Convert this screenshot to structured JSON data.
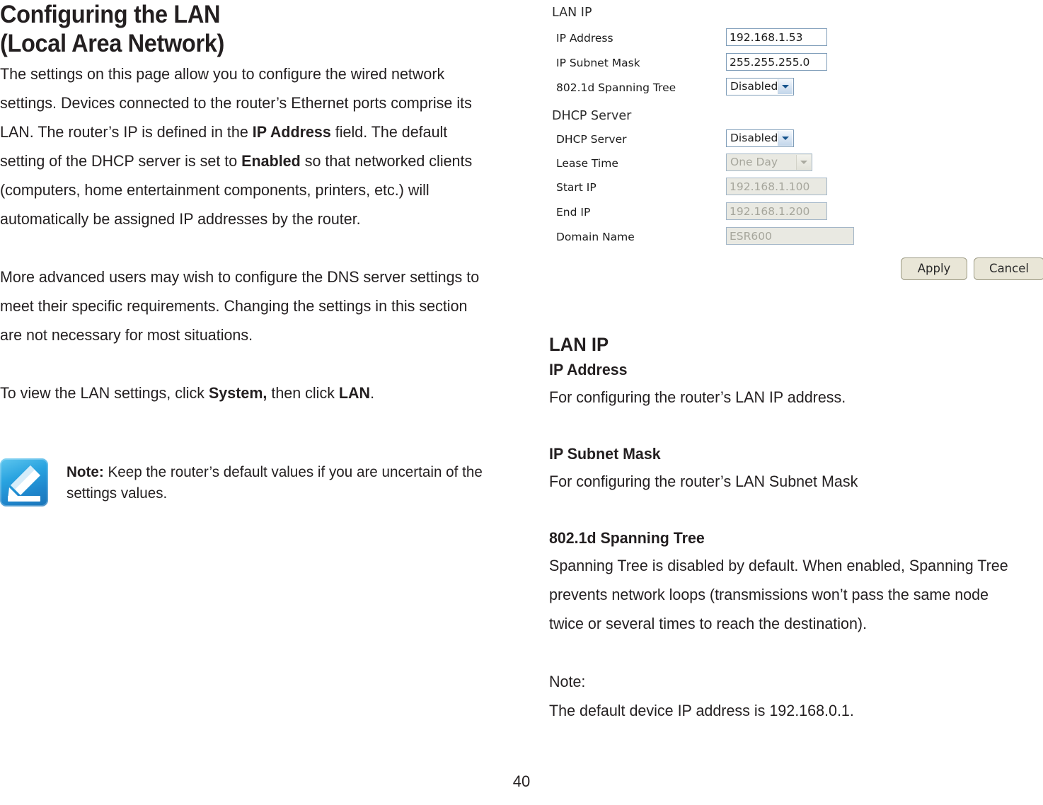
{
  "document": {
    "page_number": "40"
  },
  "left": {
    "heading_line1": "Configuring the LAN",
    "heading_line2": "(Local Area Network)",
    "para1_part1": "The settings on this page allow you to configure the wired network settings. Devices connected to the router’s Ethernet ports comprise its LAN. The router’s IP is defined in the ",
    "para1_bold1": "IP Address",
    "para1_part2": " field. The default setting of the DHCP server is set to ",
    "para1_bold2": "Enabled",
    "para1_part3": " so that networked clients (computers, home entertainment components, printers, etc.) will automatically be assigned IP addresses by the router.",
    "para2": "More advanced users may wish to configure the DNS server settings to meet their specific requirements. Changing the settings in this section are not necessary for most situations.",
    "para3_part1": "To view the LAN settings, click ",
    "para3_bold1": "System,",
    "para3_part2": " then click ",
    "para3_bold2": "LAN",
    "para3_part3": ".",
    "note_label": "Note:",
    "note_text": " Keep the router’s default values if you are uncertain of the settings values."
  },
  "right": {
    "section_heading": "LAN IP",
    "items": [
      {
        "heading": "IP Address",
        "body": "For configuring the router’s LAN IP address."
      },
      {
        "heading": "IP Subnet Mask",
        "body": "For configuring the router’s LAN Subnet Mask"
      },
      {
        "heading": "802.1d Spanning Tree",
        "body": "Spanning Tree is disabled by default. When enabled, Spanning Tree prevents network loops (transmissions won’t pass the same node twice or several times to reach the destination)."
      }
    ],
    "note_label": "Note:",
    "note_body": "The default device IP address is 192.168.0.1."
  },
  "screenshot": {
    "lan_ip": {
      "section_title": "LAN IP",
      "ip_address_label": "IP Address",
      "ip_address_value": "192.168.1.53",
      "ip_subnet_mask_label": "IP Subnet Mask",
      "ip_subnet_mask_value": "255.255.255.0",
      "spanning_tree_label": "802.1d Spanning Tree",
      "spanning_tree_value": "Disabled"
    },
    "dhcp_server": {
      "section_title": "DHCP Server",
      "dhcp_server_label": "DHCP Server",
      "dhcp_server_value": "Disabled",
      "lease_time_label": "Lease Time",
      "lease_time_value": "One Day",
      "start_ip_label": "Start IP",
      "start_ip_value": "192.168.1.100",
      "end_ip_label": "End IP",
      "end_ip_value": "192.168.1.200",
      "domain_name_label": "Domain Name",
      "domain_name_value": "ESR600"
    },
    "buttons": {
      "apply": "Apply",
      "cancel": "Cancel"
    }
  },
  "colors": {
    "text": "#231f20",
    "note_icon_blue": "#1f86cc",
    "field_border": "#7f9db9",
    "disabled_field_bg": "#e9e9e2",
    "button_bg": "#e9e6d7"
  }
}
